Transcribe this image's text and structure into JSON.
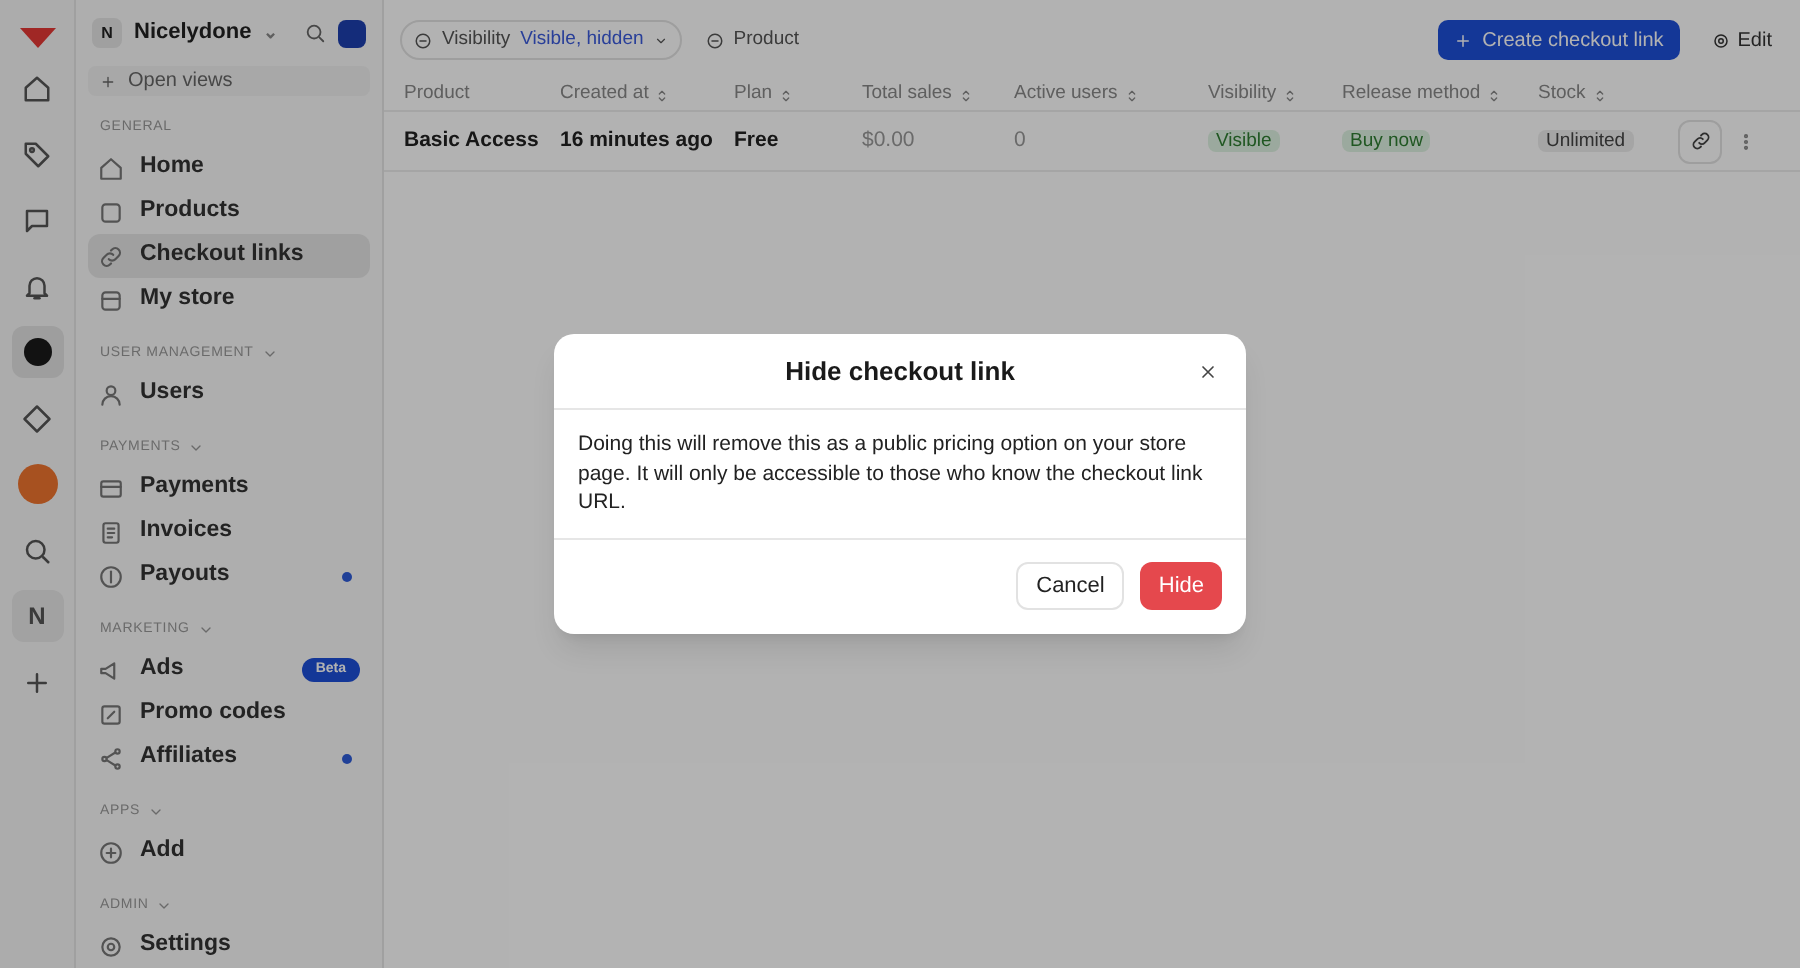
{
  "workspace": {
    "name": "Nicelydone",
    "caret": "⌄",
    "avatar": "N"
  },
  "open_views": "Open views",
  "sidebar": {
    "sections": [
      {
        "label": "GENERAL",
        "items": [
          {
            "label": "Home",
            "selected": false
          },
          {
            "label": "Products",
            "selected": false
          },
          {
            "label": "Checkout links",
            "selected": true
          },
          {
            "label": "My store",
            "selected": false
          }
        ]
      },
      {
        "label": "USER MANAGEMENT",
        "items": [
          {
            "label": "Users",
            "selected": false
          }
        ]
      },
      {
        "label": "PAYMENTS",
        "items": [
          {
            "label": "Payments",
            "selected": false
          },
          {
            "label": "Invoices",
            "selected": false
          },
          {
            "label": "Payouts",
            "selected": false,
            "dot": true
          }
        ]
      },
      {
        "label": "MARKETING",
        "items": [
          {
            "label": "Ads",
            "selected": false,
            "badge": "Beta"
          },
          {
            "label": "Promo codes",
            "selected": false
          },
          {
            "label": "Affiliates",
            "selected": false,
            "dot": true
          }
        ]
      },
      {
        "label": "APPS",
        "items": [
          {
            "label": "Add",
            "selected": false
          }
        ]
      },
      {
        "label": "ADMIN",
        "items": [
          {
            "label": "Settings",
            "selected": false
          }
        ]
      }
    ]
  },
  "rail": {
    "buttons": [
      {
        "selected": false
      },
      {
        "selected": false
      },
      {
        "selected": false
      },
      {
        "selected": false
      },
      {
        "selected": true
      },
      {
        "selected": false
      },
      {
        "selected": false
      },
      {
        "selected": false
      },
      {
        "selected": false
      },
      {
        "selected": false
      }
    ],
    "user_initial": "N"
  },
  "filters": [
    {
      "label": "Visibility",
      "value": "Visible, hidden"
    },
    {
      "label": "Product"
    }
  ],
  "toolbar": {
    "create_button": "Create checkout link",
    "edit_button": "Edit"
  },
  "table": {
    "columns": [
      "Product",
      "Created at",
      "Plan",
      "Total sales",
      "Active users",
      "Visibility",
      "Release method",
      "Stock"
    ],
    "rows": [
      {
        "cells": [
          "Basic Access",
          "16 minutes ago",
          "Free",
          "$0.00",
          "0",
          "Visible",
          "Buy now",
          "Unlimited"
        ]
      }
    ]
  },
  "dialog": {
    "title": "Hide checkout link",
    "body": "Doing this will remove this as a public pricing option on your store page. It will only be accessible to those who know the checkout link URL.",
    "buttons": [
      {
        "label": "Cancel",
        "kind": "secondary"
      },
      {
        "label": "Hide",
        "kind": "danger"
      }
    ]
  }
}
